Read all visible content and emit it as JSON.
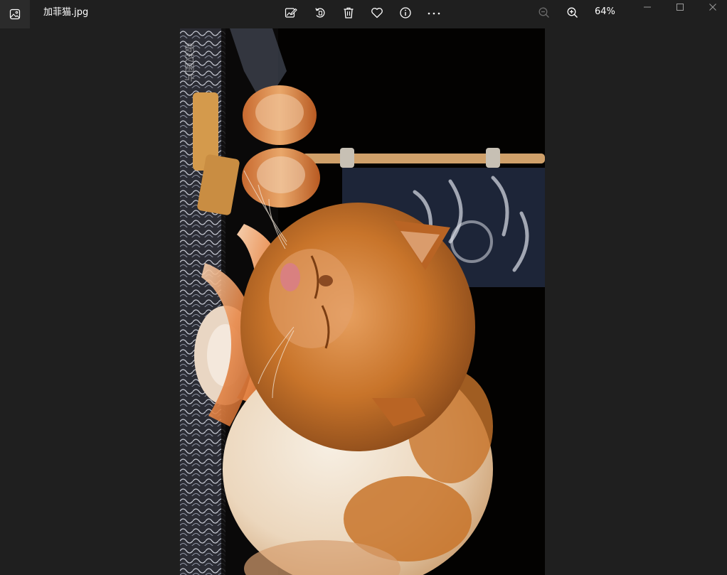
{
  "window": {
    "file_name": "加菲猫.jpg",
    "zoom_level": "64%"
  },
  "toolbar": {
    "items": [
      {
        "name": "edit-image",
        "icon": "edit-image-icon"
      },
      {
        "name": "rotate",
        "icon": "rotate-icon"
      },
      {
        "name": "delete",
        "icon": "trash-icon"
      },
      {
        "name": "favorite",
        "icon": "heart-icon"
      },
      {
        "name": "info",
        "icon": "info-icon"
      },
      {
        "name": "more",
        "icon": "more-icon"
      },
      {
        "name": "zoom-out",
        "icon": "zoom-out-icon"
      },
      {
        "name": "zoom-in",
        "icon": "zoom-in-icon"
      }
    ]
  },
  "window_controls": [
    "minimize-icon",
    "maximize-icon",
    "close-icon"
  ],
  "photo": {
    "subject": "orange-white-exotic-shorthair-cat-licking-shrimp-sushi",
    "watermark": "版权图片",
    "colors": {
      "background": "#030201",
      "fur_orange": "#c8742a",
      "fur_white": "#f1e4d2",
      "banner": "#1d2538"
    }
  }
}
